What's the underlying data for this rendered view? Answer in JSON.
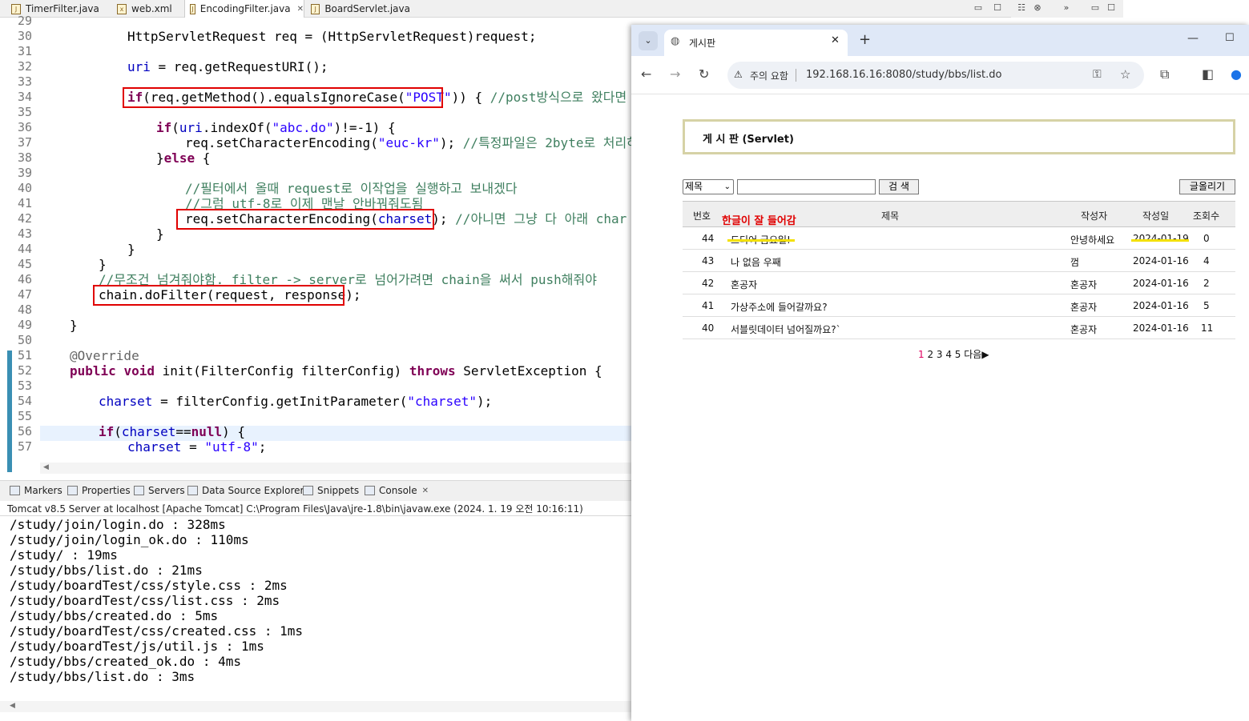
{
  "eclipse": {
    "tabs": [
      "TimerFilter.java",
      "web.xml",
      "EncodingFilter.java",
      "BoardServlet.java"
    ],
    "line_numbers": [
      "29",
      "30",
      "31",
      "32",
      "33",
      "34",
      "35",
      "36",
      "37",
      "38",
      "39",
      "40",
      "41",
      "42",
      "43",
      "44",
      "45",
      "46",
      "47",
      "48",
      "49",
      "50",
      "51",
      "52",
      "53",
      "54",
      "55",
      "56",
      "57"
    ],
    "code": {
      "l30": "HttpServletRequest req = (HttpServletRequest)request;",
      "l32": "uri = req.getRequestURI();",
      "l34a": "if(req.getMethod().equalsIgnoreCase(\"POST\"))",
      "l34b": " { //post방식으로 왔다면",
      "l36": "if(uri.indexOf(\"abc.do\")!=-1) {",
      "l37": "req.setCharacterEncoding(\"euc-kr\"); //특정파일은 2byte로 처리하",
      "l38": "}else {",
      "l40": "//필터에서 올때 request로 이작업을 실행하고 보내겠다",
      "l41": "//그럼 utf-8로 이제 맨날 안바꿔줘도됨",
      "l42a": "req.setCharacterEncoding(charset);",
      "l42b": " //아니면 그냥 다 아래 char",
      "l43": "}",
      "l44": "}",
      "l45": "}",
      "l46": "//무조건 넘겨줘야함. filter -> server로 넘어가려면 chain을 써서 push해줘야",
      "l47": "chain.doFilter(request, response);",
      "l49": "}",
      "l51": "@Override",
      "l52": "public void init(FilterConfig filterConfig) throws ServletException {",
      "l54": "charset = filterConfig.getInitParameter(\"charset\");",
      "l56": "if(charset==null) {",
      "l57": "charset = \"utf-8\";"
    },
    "console_tabs": [
      "Markers",
      "Properties",
      "Servers",
      "Data Source Explorer",
      "Snippets",
      "Console"
    ],
    "console_desc": "Tomcat v8.5 Server at localhost [Apache Tomcat] C:\\Program Files\\Java\\jre-1.8\\bin\\javaw.exe  (2024. 1. 19 오전 10:16:11)",
    "console_lines": [
      "/study/join/login.do : 328ms",
      "/study/join/login_ok.do : 110ms",
      "/study/ : 19ms",
      "/study/bbs/list.do : 21ms",
      "/study/boardTest/css/style.css : 2ms",
      "/study/boardTest/css/list.css : 2ms",
      "/study/bbs/created.do : 5ms",
      "/study/boardTest/css/created.css : 1ms",
      "/study/boardTest/js/util.js : 1ms",
      "/study/bbs/created_ok.do : 4ms",
      "/study/bbs/list.do : 3ms"
    ]
  },
  "browser": {
    "tab_title": "게시판",
    "security_label": "주의 요함",
    "url": "192.168.16.16:8080/study/bbs/list.do",
    "page": {
      "title": "게 시 판 (Servlet)",
      "search_option": "제목",
      "search_button": "검 색",
      "write_button": "글올리기",
      "headers": [
        "번호",
        "제목",
        "작성자",
        "작성일",
        "조회수"
      ],
      "annotation": "한글이 잘 들어감",
      "rows": [
        {
          "num": "44",
          "subject": "드디어 금요일!",
          "author": "안녕하세요",
          "date": "2024-01-19",
          "hits": "0"
        },
        {
          "num": "43",
          "subject": "나 없음 우째",
          "author": "껌",
          "date": "2024-01-16",
          "hits": "4"
        },
        {
          "num": "42",
          "subject": "혼공자",
          "author": "혼공자",
          "date": "2024-01-16",
          "hits": "2"
        },
        {
          "num": "41",
          "subject": "가상주소에 들어갈까요?",
          "author": "혼공자",
          "date": "2024-01-16",
          "hits": "5"
        },
        {
          "num": "40",
          "subject": "서블릿데이터 넘어질까요?`",
          "author": "혼공자",
          "date": "2024-01-16",
          "hits": "11"
        }
      ],
      "paging_current": "1",
      "paging_rest": " 2 3 4 5 다음▶"
    }
  },
  "colors": {
    "keyword": "#7f0055",
    "string": "#2a00ff",
    "field": "#0000c0",
    "comment": "#3f7f5f",
    "box": "#e00000",
    "annotation": "#e00000",
    "highlight": "#f3e000"
  }
}
